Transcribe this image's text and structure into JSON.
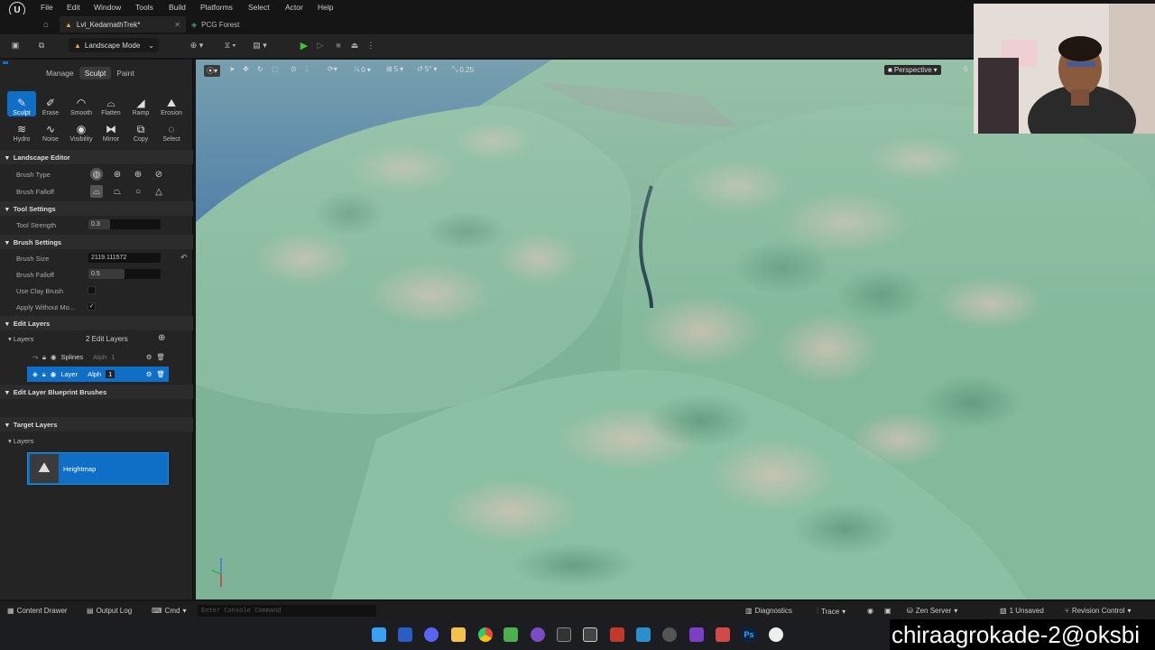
{
  "menu": [
    "File",
    "Edit",
    "Window",
    "Tools",
    "Build",
    "Platforms",
    "Select",
    "Actor",
    "Help"
  ],
  "tabs": {
    "level": "Lvl_KedarnathTrek*",
    "other": "PCG Forest"
  },
  "toolbar": {
    "mode": "Landscape Mode"
  },
  "landscape_tabs": [
    "Manage",
    "Sculpt",
    "Paint"
  ],
  "tools_row1": [
    "Sculpt",
    "Erase",
    "Smooth",
    "Flatten",
    "Ramp",
    "Erosion"
  ],
  "tools_row2": [
    "Hydro",
    "Noise",
    "Visibility",
    "Mirror",
    "Copy",
    "Select"
  ],
  "sections": {
    "landscape_editor": "Landscape Editor",
    "tool_settings": "Tool Settings",
    "brush_settings": "Brush Settings",
    "edit_layers": "Edit Layers",
    "edit_layer_bp": "Edit Layer Blueprint Brushes",
    "target_layers": "Target Layers"
  },
  "labels": {
    "brush_type": "Brush Type",
    "brush_falloff": "Brush Falloff",
    "tool_strength": "Tool Strength",
    "brush_size": "Brush Size",
    "brush_falloff2": "Brush Falloff",
    "use_clay": "Use Clay Brush",
    "apply_without": "Apply Without Mo...",
    "layers": "Layers",
    "layers2": "Layers"
  },
  "values": {
    "tool_strength": "0.3",
    "tool_strength_level": 0.3,
    "brush_size": "2119.111572",
    "brush_falloff": "0.5",
    "brush_falloff_level": 0.5
  },
  "edit_layers": {
    "count": "2 Edit Layers",
    "rows": [
      {
        "name": "Splines",
        "alpha_label": "Alph",
        "alpha": "1"
      },
      {
        "name": "Layer",
        "alpha_label": "Alph",
        "alpha": "1"
      }
    ]
  },
  "target_layer": "Heightmap",
  "viewport": {
    "snap_loc": "0",
    "snap_grid": "5",
    "snap_rot": "5°",
    "snap_scale": "0.25",
    "view": "Perspective",
    "extra": "6"
  },
  "bottom": {
    "content_drawer": "Content Drawer",
    "output_log": "Output Log",
    "cmd": "Cmd",
    "console_placeholder": "Enter Console Command",
    "diagnostics": "Diagnostics",
    "trace": "Trace",
    "zen": "Zen Server",
    "unsaved": "1 Unsaved",
    "revision": "Revision Control"
  },
  "watermark": "chiraagrokade-2@oksbi",
  "colors": {
    "accent": "#0f6fc6",
    "terrain": "#7fb398",
    "sky": "#3b6ba5",
    "play": "#3cc43c"
  }
}
